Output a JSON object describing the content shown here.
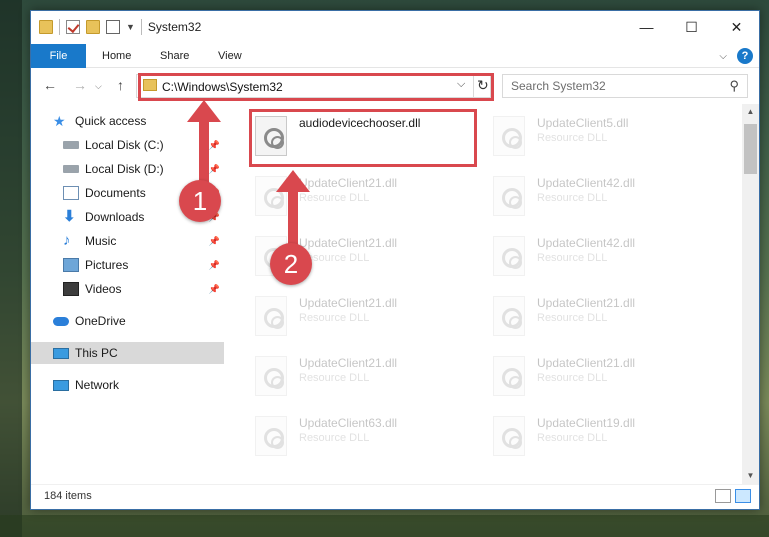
{
  "window": {
    "title": "System32",
    "controls": {
      "minimize": "—",
      "maximize": "☐",
      "close": "✕"
    }
  },
  "ribbon": {
    "tabs": [
      "File",
      "Home",
      "Share",
      "View"
    ],
    "help": "?"
  },
  "navigation": {
    "back": "←",
    "forward": "→",
    "up": "↑",
    "address": "C:\\Windows\\System32",
    "dropdown": "⌵",
    "refresh": "↻",
    "search_placeholder": "Search System32"
  },
  "sidebar": {
    "items": [
      {
        "label": "Quick access",
        "icon": "star-icon",
        "pinned": false
      },
      {
        "label": "Local Disk (C:)",
        "icon": "drive-icon",
        "pinned": true
      },
      {
        "label": "Local Disk (D:)",
        "icon": "drive-icon",
        "pinned": true
      },
      {
        "label": "Documents",
        "icon": "documents-icon",
        "pinned": true
      },
      {
        "label": "Downloads",
        "icon": "download-icon",
        "pinned": true
      },
      {
        "label": "Music",
        "icon": "music-icon",
        "pinned": true
      },
      {
        "label": "Pictures",
        "icon": "pictures-icon",
        "pinned": true
      },
      {
        "label": "Videos",
        "icon": "videos-icon",
        "pinned": true
      },
      {
        "label": "OneDrive",
        "icon": "cloud-icon",
        "pinned": false
      },
      {
        "label": "This PC",
        "icon": "computer-icon",
        "pinned": false
      },
      {
        "label": "Network",
        "icon": "network-icon",
        "pinned": false
      }
    ],
    "pin_glyph": "📌"
  },
  "files": [
    {
      "name": "audiodevicechooser.dll",
      "type": ""
    },
    {
      "name": "UpdateClient5.dll",
      "type": "Resource DLL"
    },
    {
      "name": "UpdateClient21.dll",
      "type": "Resource DLL"
    },
    {
      "name": "UpdateClient42.dll",
      "type": "Resource DLL"
    },
    {
      "name": "UpdateClient21.dll",
      "type": "Resource DLL"
    },
    {
      "name": "UpdateClient42.dll",
      "type": "Resource DLL"
    },
    {
      "name": "UpdateClient21.dll",
      "type": "Resource DLL"
    },
    {
      "name": "UpdateClient21.dll",
      "type": "Resource DLL"
    },
    {
      "name": "UpdateClient21.dll",
      "type": "Resource DLL"
    },
    {
      "name": "UpdateClient21.dll",
      "type": "Resource DLL"
    },
    {
      "name": "UpdateClient63.dll",
      "type": "Resource DLL"
    },
    {
      "name": "UpdateClient19.dll",
      "type": "Resource DLL"
    }
  ],
  "status": {
    "item_count": "184 items"
  },
  "annotations": {
    "step1": "1",
    "step2": "2"
  },
  "colors": {
    "accent": "#1979ca",
    "annotation": "#d9484e",
    "selection": "#cce8ff"
  }
}
